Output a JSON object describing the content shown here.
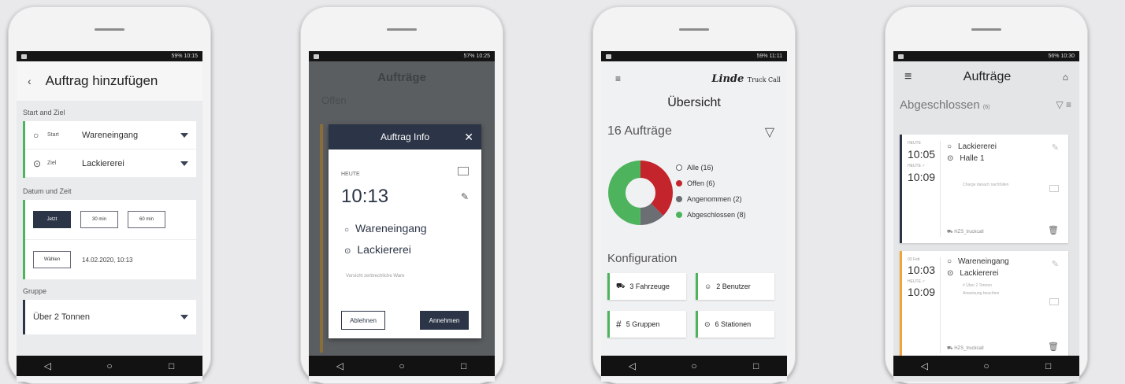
{
  "phone1": {
    "status": "59% 10:15",
    "title": "Auftrag hinzufügen",
    "sec_start_ziel": "Start and Ziel",
    "start_label": "Start",
    "start_value": "Wareneingang",
    "ziel_label": "Ziel",
    "ziel_value": "Lackiererei",
    "sec_datum": "Datum und Zeit",
    "btn_jetzt": "Jetzt",
    "btn_30": "30 min",
    "btn_60": "60 min",
    "btn_wahlen": "Wählen",
    "datetime": "14.02.2020, 10:13",
    "sec_gruppe": "Gruppe",
    "gruppe_value": "Über 2 Tonnen"
  },
  "phone2": {
    "status": "57% 10:25",
    "bg_title": "Aufträge",
    "bg_filter": "Offen",
    "modal_title": "Auftrag Info",
    "heute": "HEUTE",
    "time": "10:13",
    "from": "Wareneingang",
    "to": "Lackiererei",
    "note": "Vorsicht zerbrechliche Ware",
    "btn_decline": "Ablehnen",
    "btn_accept": "Annehmen"
  },
  "phone3": {
    "status": "59% 11:11",
    "brand": "Linde",
    "brand_sub": "Truck Call",
    "title": "Übersicht",
    "count": "16 Aufträge",
    "legend": [
      "Alle (16)",
      "Offen (6)",
      "Angenommen (2)",
      "Abgeschlossen (8)"
    ],
    "konf": "Konfiguration",
    "tiles": [
      "3 Fahrzeuge",
      "2 Benutzer",
      "5 Gruppen",
      "6 Stationen"
    ]
  },
  "chart_data": {
    "type": "pie",
    "categories": [
      "Offen",
      "Angenommen",
      "Abgeschlossen"
    ],
    "values": [
      6,
      2,
      8
    ],
    "colors": [
      "#c4242b",
      "#6b6e73",
      "#4db35d"
    ]
  },
  "phone4": {
    "status": "56% 10:30",
    "title": "Aufträge",
    "filter": "Abgeschlossen",
    "filter_count": "(6)",
    "o1": {
      "lbl1": "HEUTE",
      "t1": "10:05",
      "lbl2": "HEUTE ✓",
      "t2": "10:09",
      "from": "Lackiererei",
      "to": "Halle 1",
      "note": "Charge danach nachfüllen",
      "user": "HZS_truckcall"
    },
    "o2": {
      "lbl1": "03 Feb",
      "t1": "10:03",
      "lbl2": "HEUTE ✓",
      "t2": "10:09",
      "from": "Wareneingang",
      "to": "Lackiererei",
      "note1": "# Über 2 Tonnen",
      "note2": "Anweisung beachten",
      "user": "HZS_truckcall"
    }
  }
}
